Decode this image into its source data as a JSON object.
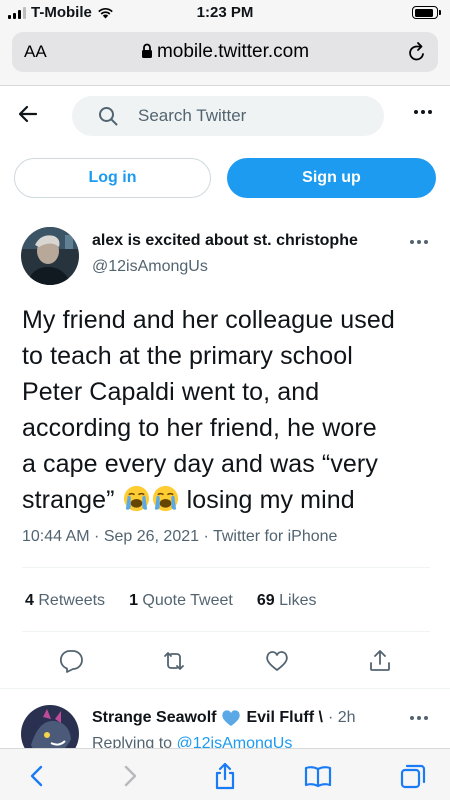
{
  "status_bar": {
    "carrier": "T-Mobile",
    "time": "1:23 PM",
    "battery_level": 0.9
  },
  "browser": {
    "text_size_label": "AA",
    "url": "mobile.twitter.com"
  },
  "header": {
    "search_placeholder": "Search Twitter"
  },
  "auth": {
    "login_label": "Log in",
    "signup_label": "Sign up"
  },
  "tweet": {
    "display_name": "alex is excited about st. christophe",
    "handle": "@12isAmongUs",
    "text_lines": [
      "My friend and her colleague used",
      "to teach at the primary school",
      "Peter Capaldi went to, and",
      "according to her friend, he wore",
      "a cape every day and was “very",
      "strange”",
      "losing my mind"
    ],
    "emoji": [
      "loudly-crying-face",
      "loudly-crying-face"
    ],
    "timestamp": "10:44 AM · Sep 26, 2021 · Twitter for iPhone",
    "retweets_count": "4",
    "retweets_label": "Retweets",
    "quotes_count": "1",
    "quotes_label": "Quote Tweet",
    "likes_count": "69",
    "likes_label": "Likes"
  },
  "reply": {
    "display_name": "Strange Seawolf",
    "display_name_2": "Evil Fluff \\",
    "time": "· 2h",
    "replying_prefix": "Replying to",
    "replying_handle": "@12isAmongUs"
  },
  "colors": {
    "accent": "#1d9bf0",
    "text": "#0f1419",
    "secondary": "#536471",
    "heart_emoji": "#5aa9e6"
  }
}
